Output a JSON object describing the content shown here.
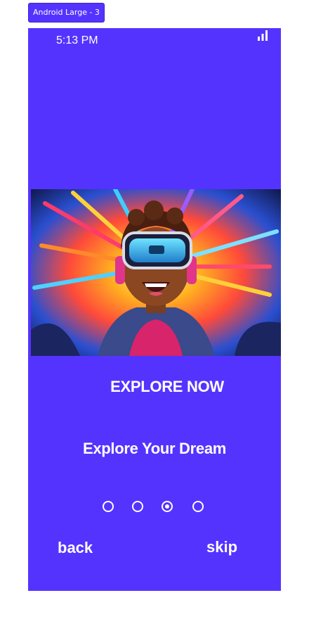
{
  "frame_label": "Android Large - 3",
  "status_bar": {
    "time": "5:13 PM",
    "signal_icon": "signal-icon"
  },
  "hero_image": {
    "icon": "vr-kid-illustration"
  },
  "heading": "EXPLORE NOW",
  "subtitle": "Explore Your Dream",
  "pager": {
    "count": 4,
    "active_index": 2
  },
  "buttons": {
    "back": "back",
    "skip": "skip"
  },
  "colors": {
    "background": "#5533ff",
    "text": "#ffffff"
  }
}
